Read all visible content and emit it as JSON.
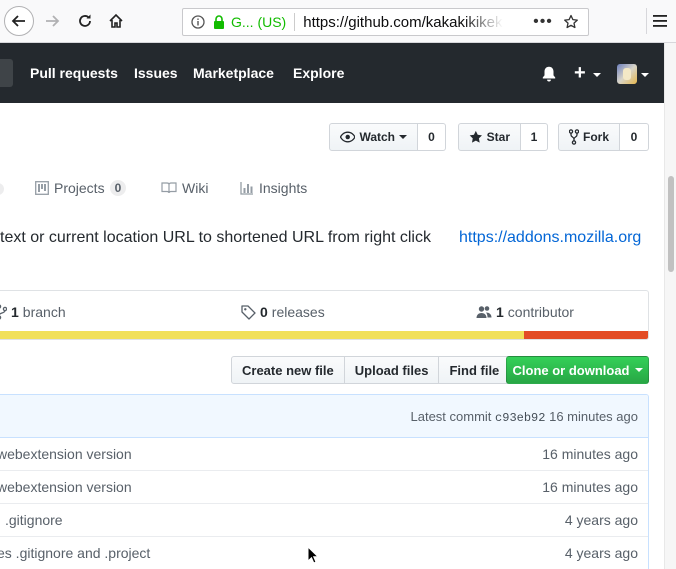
{
  "browser": {
    "identity": "G... (US)",
    "url": "https://github.com/kakakikikek"
  },
  "header": {
    "nav": [
      "Pull requests",
      "Issues",
      "Marketplace",
      "Explore"
    ]
  },
  "repo_actions": {
    "watch_label": "Watch",
    "watch_count": "0",
    "star_label": "Star",
    "star_count": "1",
    "fork_label": "Fork",
    "fork_count": "0"
  },
  "tabs": {
    "projects_label": "Projects",
    "projects_count": "0",
    "wiki_label": "Wiki",
    "insights_label": "Insights"
  },
  "description": {
    "text": "text or current location URL to shortened URL from right click",
    "link": "https://addons.mozilla.org"
  },
  "summary": {
    "branches_count": "1",
    "branches_label": "branch",
    "releases_count": "0",
    "releases_label": "releases",
    "contributors_count": "1",
    "contributors_label": "contributor",
    "languages": [
      {
        "color": "#f1e05a",
        "percent": 81
      },
      {
        "color": "#e34c26",
        "percent": 19
      }
    ]
  },
  "file_nav": {
    "create_label": "Create new file",
    "upload_label": "Upload files",
    "find_label": "Find file",
    "clone_label": "Clone or download"
  },
  "commit": {
    "prefix": "Latest commit",
    "sha": "c93eb92",
    "age": "16 minutes ago"
  },
  "files": [
    {
      "message": "webextension version",
      "age": "16 minutes ago"
    },
    {
      "message": "webextension version",
      "age": "16 minutes ago"
    },
    {
      "message": ".gitignore",
      "age": "4 years ago"
    },
    {
      "message": "es .gitignore and .project",
      "age": "4 years ago"
    }
  ]
}
